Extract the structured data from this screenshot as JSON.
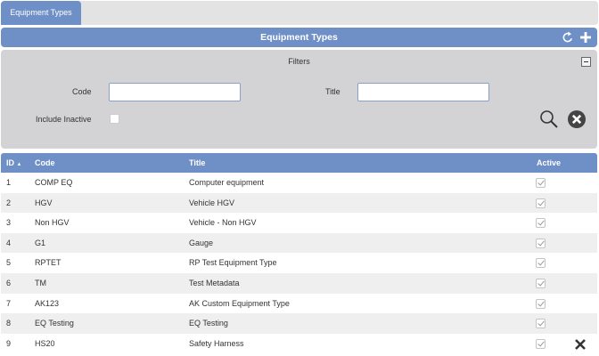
{
  "tabs": [
    {
      "label": "Equipment Types"
    }
  ],
  "header": {
    "title": "Equipment Types",
    "refresh_icon": "refresh-icon",
    "add_icon": "plus-icon"
  },
  "filters": {
    "title": "Filters",
    "code_label": "Code",
    "code_value": "",
    "title_label": "Title",
    "title_value": "",
    "include_inactive_label": "Include Inactive",
    "include_inactive_checked": false,
    "search_icon": "magnifier-icon",
    "clear_icon": "clear-x-icon"
  },
  "grid": {
    "columns": {
      "id": "ID",
      "code": "Code",
      "title": "Title",
      "active": "Active"
    },
    "sort_indicator": "▲",
    "rows": [
      {
        "id": "1",
        "code": "COMP EQ",
        "title": "Computer equipment",
        "active": true
      },
      {
        "id": "2",
        "code": "HGV",
        "title": "Vehicle HGV",
        "active": true
      },
      {
        "id": "3",
        "code": "Non HGV",
        "title": "Vehicle - Non HGV",
        "active": true
      },
      {
        "id": "4",
        "code": "G1",
        "title": "Gauge",
        "active": true
      },
      {
        "id": "5",
        "code": "RPTET",
        "title": "RP Test Equipment Type",
        "active": true
      },
      {
        "id": "6",
        "code": "TM",
        "title": "Test Metadata",
        "active": true
      },
      {
        "id": "7",
        "code": "AK123",
        "title": "AK Custom Equipment Type",
        "active": true
      },
      {
        "id": "8",
        "code": "EQ Testing",
        "title": "EQ Testing",
        "active": true
      },
      {
        "id": "9",
        "code": "HS20",
        "title": "Safety Harness",
        "active": true
      }
    ]
  },
  "colors": {
    "accent": "#6f8fc7",
    "filter_panel": "#d3d3d6",
    "alt_row": "#efefef"
  }
}
